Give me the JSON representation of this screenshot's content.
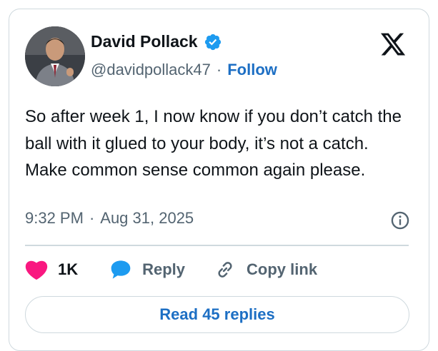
{
  "author": {
    "name": "David Pollack",
    "handle": "@davidpollack47",
    "separator": "·",
    "follow_label": "Follow",
    "verified_icon": "verified-badge-icon",
    "avatar": "profile-photo"
  },
  "tweet": {
    "text": "So after week 1, I now know if you don’t catch the ball with it glued to your body, it’s not a catch. Make common sense common again please.",
    "time": "9:32 PM",
    "separator": "·",
    "date": "Aug 31, 2025"
  },
  "actions": {
    "like_count": "1K",
    "reply_label": "Reply",
    "copy_label": "Copy link"
  },
  "footer": {
    "read_replies_label": "Read 45 replies"
  },
  "colors": {
    "link_blue": "#1d6fc4",
    "verified_blue": "#1d9bf0",
    "like_pink": "#f91880",
    "secondary_text": "#536471",
    "border": "#cfd9de"
  },
  "icons": [
    "x-logo-icon",
    "verified-badge-icon",
    "info-icon",
    "heart-icon",
    "reply-bubble-icon",
    "link-icon"
  ]
}
